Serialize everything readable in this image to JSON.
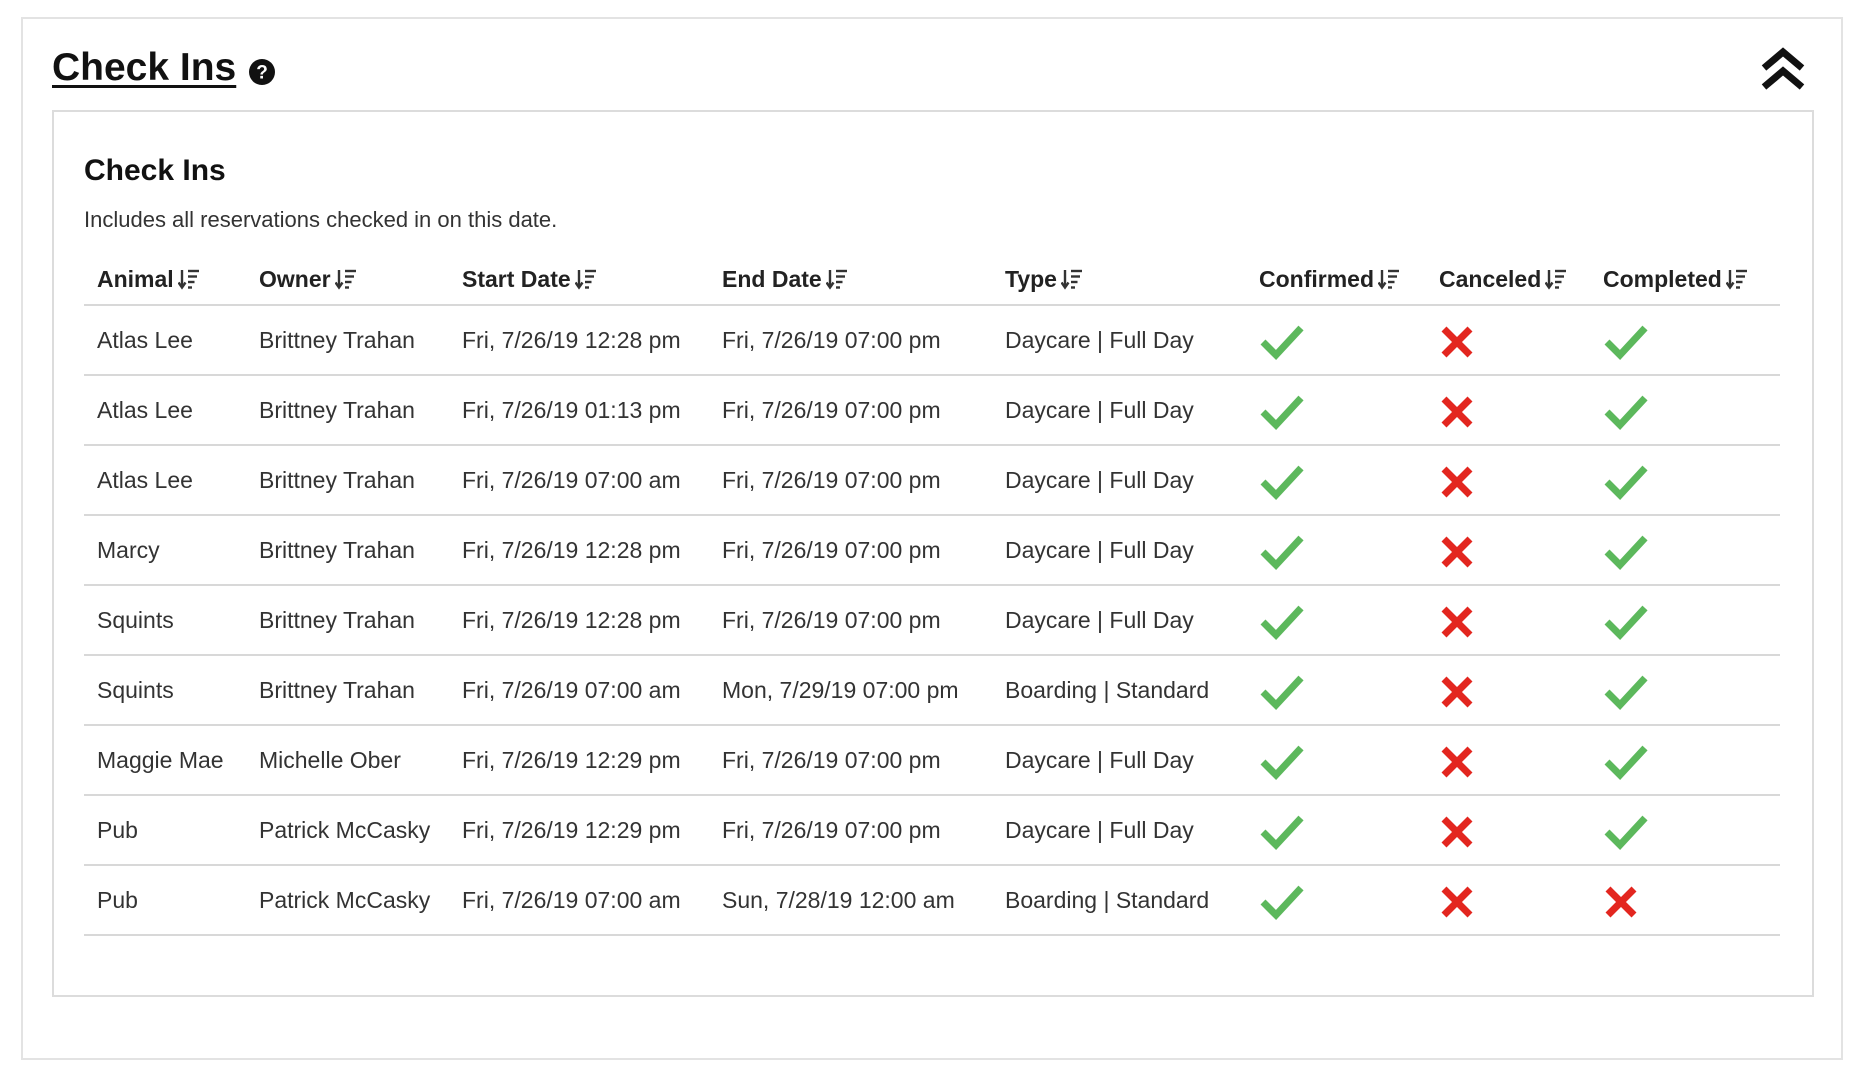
{
  "panel": {
    "title": "Check Ins",
    "help_icon": "question-circle-icon",
    "collapse_icon": "double-chevron-up-icon"
  },
  "report": {
    "title": "Check Ins",
    "subtitle": "Includes all reservations checked in on this date."
  },
  "table": {
    "columns": [
      "Animal",
      "Owner",
      "Start Date",
      "End Date",
      "Type",
      "Confirmed",
      "Canceled",
      "Completed"
    ],
    "sort_icon": "sort-descending-icon",
    "rows": [
      {
        "animal": "Atlas Lee",
        "owner": "Brittney Trahan",
        "start": "Fri, 7/26/19 12:28 pm",
        "end": "Fri, 7/26/19 07:00 pm",
        "type": "Daycare | Full Day",
        "confirmed": true,
        "canceled": false,
        "completed": true
      },
      {
        "animal": "Atlas Lee",
        "owner": "Brittney Trahan",
        "start": "Fri, 7/26/19 01:13 pm",
        "end": "Fri, 7/26/19 07:00 pm",
        "type": "Daycare | Full Day",
        "confirmed": true,
        "canceled": false,
        "completed": true
      },
      {
        "animal": "Atlas Lee",
        "owner": "Brittney Trahan",
        "start": "Fri, 7/26/19 07:00 am",
        "end": "Fri, 7/26/19 07:00 pm",
        "type": "Daycare | Full Day",
        "confirmed": true,
        "canceled": false,
        "completed": true
      },
      {
        "animal": "Marcy",
        "owner": "Brittney Trahan",
        "start": "Fri, 7/26/19 12:28 pm",
        "end": "Fri, 7/26/19 07:00 pm",
        "type": "Daycare | Full Day",
        "confirmed": true,
        "canceled": false,
        "completed": true
      },
      {
        "animal": "Squints",
        "owner": "Brittney Trahan",
        "start": "Fri, 7/26/19 12:28 pm",
        "end": "Fri, 7/26/19 07:00 pm",
        "type": "Daycare | Full Day",
        "confirmed": true,
        "canceled": false,
        "completed": true
      },
      {
        "animal": "Squints",
        "owner": "Brittney Trahan",
        "start": "Fri, 7/26/19 07:00 am",
        "end": "Mon, 7/29/19 07:00 pm",
        "type": "Boarding | Standard",
        "confirmed": true,
        "canceled": false,
        "completed": true
      },
      {
        "animal": "Maggie Mae",
        "owner": "Michelle Ober",
        "start": "Fri, 7/26/19 12:29 pm",
        "end": "Fri, 7/26/19 07:00 pm",
        "type": "Daycare | Full Day",
        "confirmed": true,
        "canceled": false,
        "completed": true
      },
      {
        "animal": "Pub",
        "owner": "Patrick McCasky",
        "start": "Fri, 7/26/19 12:29 pm",
        "end": "Fri, 7/26/19 07:00 pm",
        "type": "Daycare | Full Day",
        "confirmed": true,
        "canceled": false,
        "completed": true
      },
      {
        "animal": "Pub",
        "owner": "Patrick McCasky",
        "start": "Fri, 7/26/19 07:00 am",
        "end": "Sun, 7/28/19 12:00 am",
        "type": "Boarding | Standard",
        "confirmed": true,
        "canceled": false,
        "completed": false
      }
    ]
  },
  "colors": {
    "check": "#5cb85c",
    "cross": "#e3261f",
    "border": "#d8d8d8"
  },
  "status_icons": {
    "true": "check-icon",
    "false": "cross-icon"
  }
}
